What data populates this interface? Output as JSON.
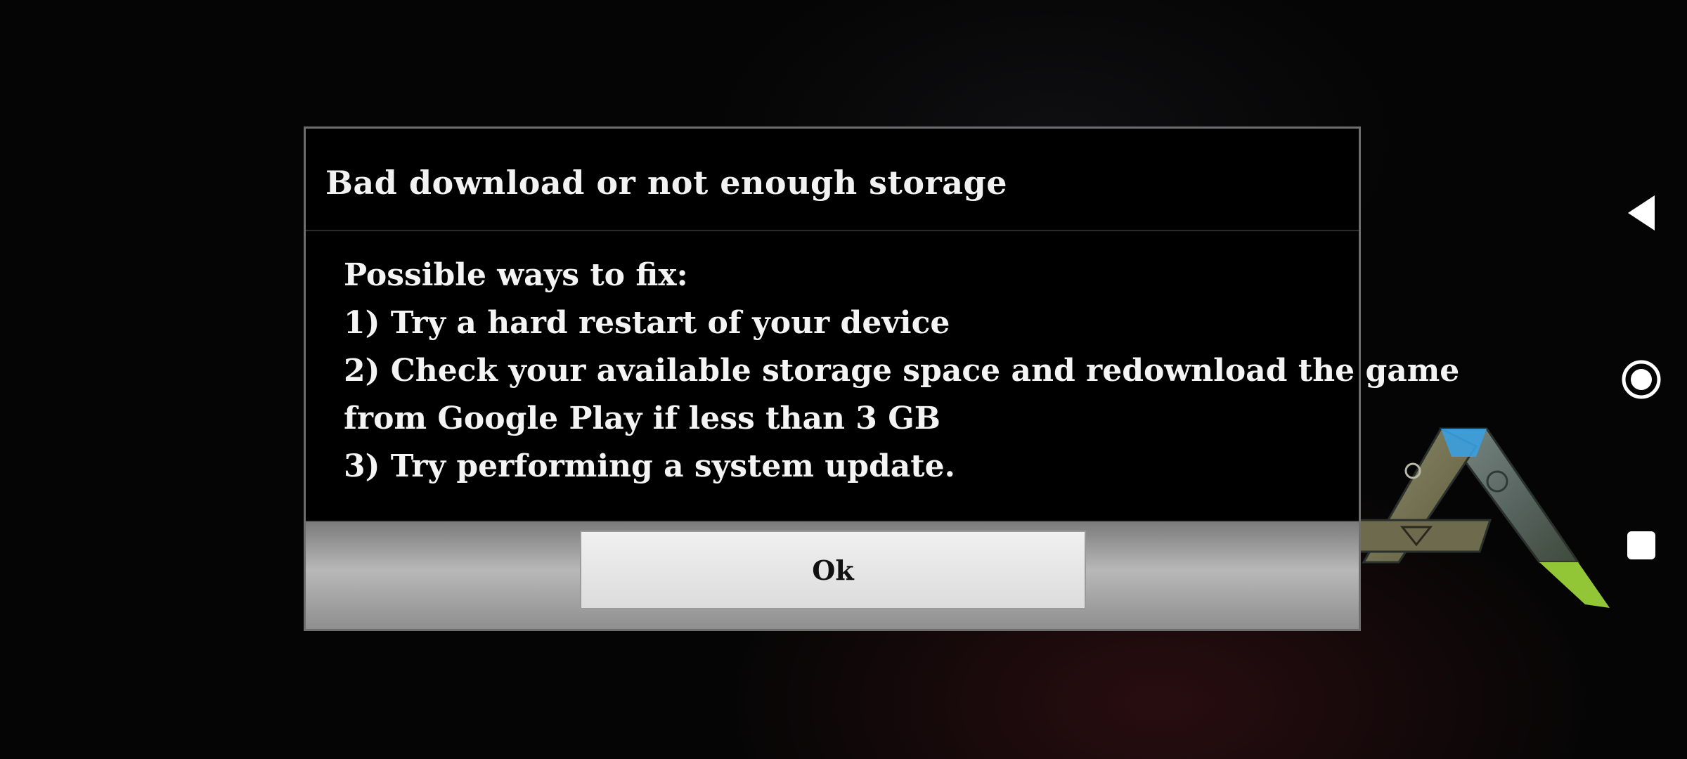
{
  "dialog": {
    "title": "Bad download or not enough storage",
    "body_lines": [
      "Possible ways to fix:",
      "1) Try a hard restart of your device",
      "2) Check your available storage space and redownload the game",
      "from Google Play if less than 3 GB",
      "3) Try performing a system update."
    ],
    "ok_label": "Ok"
  },
  "nav_bar": {
    "back_icon": "back-triangle-icon",
    "home_icon": "home-circle-icon",
    "recents_icon": "recents-square-icon"
  },
  "colors": {
    "dialog_background": "#000000",
    "dialog_border": "#6e6e6e",
    "button_bar": "#b8b8b8",
    "ok_button": "#e6e6e6",
    "text": "#f2f2f2",
    "logo_blue": "#3aa0e0",
    "logo_green": "#9bd13a"
  }
}
